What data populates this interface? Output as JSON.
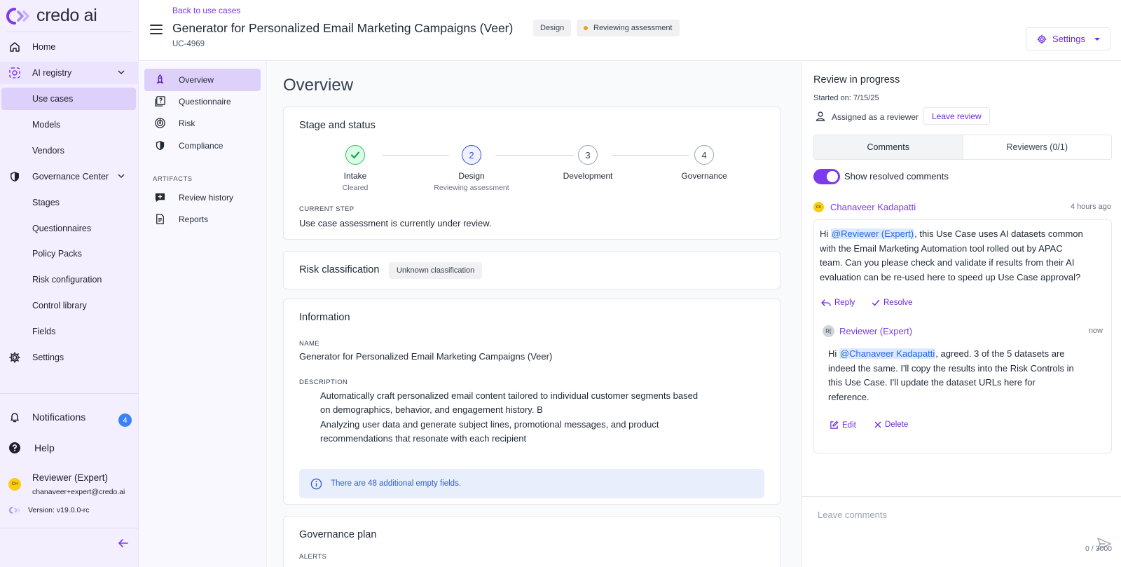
{
  "brand": {
    "logo_text": "credo ai"
  },
  "sidebar": {
    "items": [
      {
        "label": "Home"
      },
      {
        "label": "AI registry"
      },
      {
        "label": "Use cases"
      },
      {
        "label": "Models"
      },
      {
        "label": "Vendors"
      },
      {
        "label": "Governance Center"
      },
      {
        "label": "Stages"
      },
      {
        "label": "Questionnaires"
      },
      {
        "label": "Policy Packs"
      },
      {
        "label": "Risk configuration"
      },
      {
        "label": "Control library"
      },
      {
        "label": "Fields"
      },
      {
        "label": "Settings"
      }
    ],
    "notifications": {
      "label": "Notifications",
      "count": "4"
    },
    "help": {
      "label": "Help"
    },
    "user": {
      "name": "Reviewer (Expert)",
      "email": "chanaveer+expert@credo.ai",
      "initials": "CH"
    },
    "version": "Version: v19.0.0-rc"
  },
  "header": {
    "back_link": "Back to use cases",
    "title": "Generator for Personalized Email Marketing Campaigns (Veer)",
    "stage_tag": "Design",
    "status_tag": "Reviewing assessment",
    "uc_id": "UC-4969",
    "settings_label": "Settings"
  },
  "subnav": {
    "items": [
      {
        "label": "Overview"
      },
      {
        "label": "Questionnaire"
      },
      {
        "label": "Risk"
      },
      {
        "label": "Compliance"
      }
    ],
    "artifacts_heading": "ARTIFACTS",
    "artifacts": [
      {
        "label": "Review history"
      },
      {
        "label": "Reports"
      }
    ]
  },
  "main": {
    "title": "Overview",
    "stage_card": {
      "title": "Stage and status",
      "steps": [
        {
          "number": "",
          "name": "Intake",
          "status": "Cleared"
        },
        {
          "number": "2",
          "name": "Design",
          "status": "Reviewing assessment"
        },
        {
          "number": "3",
          "name": "Development",
          "status": ""
        },
        {
          "number": "4",
          "name": "Governance",
          "status": ""
        }
      ],
      "current_step_label": "CURRENT STEP",
      "current_step_text": "Use case assessment is currently under review."
    },
    "risk_card": {
      "title": "Risk classification",
      "badge": "Unknown classification"
    },
    "info_card": {
      "title": "Information",
      "name_label": "NAME",
      "name_value": "Generator for Personalized Email Marketing Campaigns (Veer)",
      "description_label": "DESCRIPTION",
      "description_lines": [
        "Automatically craft personalized email content tailored to individual customer segments based",
        "on demographics, behavior, and engagement history. B",
        "Analyzing user data and generate subject lines, promotional messages, and product",
        "recommendations that resonate with each recipient"
      ],
      "empty_fields_notice": "There are 48 additional empty fields."
    },
    "governance_card": {
      "title": "Governance plan",
      "alerts_label": "ALERTS"
    }
  },
  "review": {
    "title": "Review in progress",
    "started": "Started on: 7/15/25",
    "assigned": "Assigned as a reviewer",
    "leave_review": "Leave review",
    "tabs": [
      {
        "label": "Comments"
      },
      {
        "label": "Reviewers (0/1)"
      }
    ],
    "show_resolved": "Show resolved comments",
    "comment": {
      "author": "Chanaveer Kadapatti",
      "initials": "CK",
      "time": "4 hours ago",
      "text_before": "Hi ",
      "mention": "@Reviewer (Expert)",
      "text_lines": [
        ", this Use Case uses AI datasets common",
        "with the Email Marketing Automation tool rolled out by APAC",
        "team. Can you please check and validate if results from their AI",
        "evaluation can be re-used here to speed up Use Case approval?"
      ],
      "reply": "Reply",
      "resolve": "Resolve"
    },
    "reply": {
      "author": "Reviewer (Expert)",
      "initials": "R(",
      "time": "now",
      "text_before": "Hi ",
      "mention": "@Chanaveer Kadapatti",
      "text_lines": [
        ", agreed. 3 of the 5 datasets are",
        "indeed the same. I'll copy the results into the Risk Controls in",
        "this Use Case. I'll update the dataset URLs here for",
        "reference."
      ],
      "edit": "Edit",
      "delete": "Delete"
    },
    "compose_placeholder": "Leave comments",
    "char_count": "0 / 3000"
  }
}
